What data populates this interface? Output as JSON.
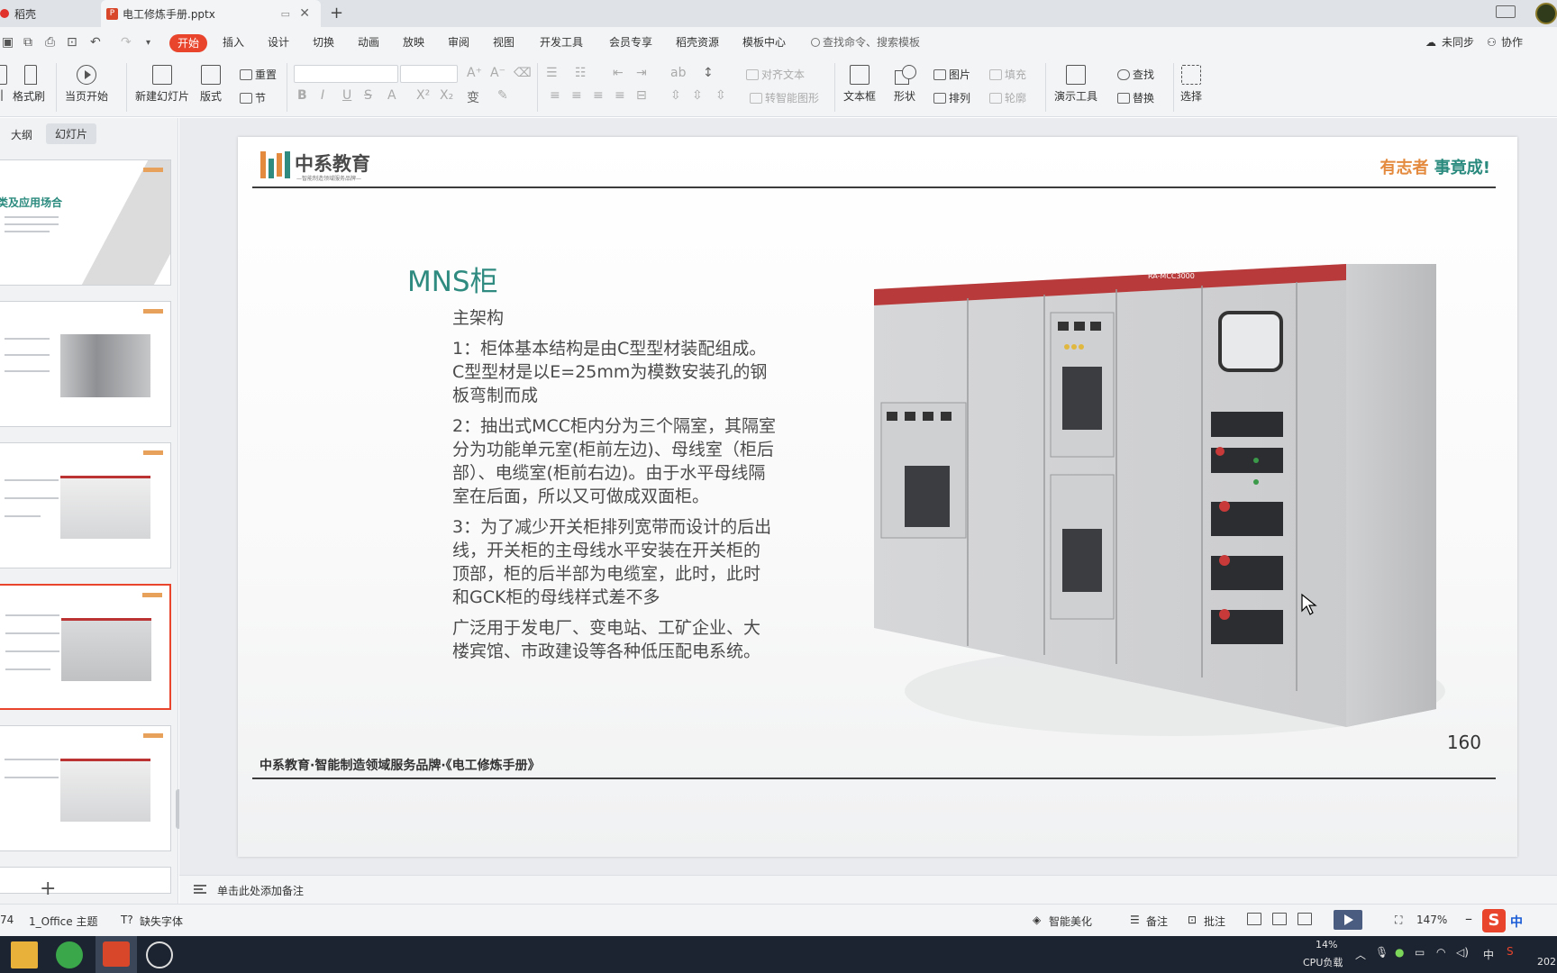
{
  "tabs": {
    "home_label": "稻壳",
    "doc_label": "电工修炼手册.pptx",
    "add": "+"
  },
  "menu": {
    "items": [
      "开始",
      "插入",
      "设计",
      "切换",
      "动画",
      "放映",
      "审阅",
      "视图",
      "开发工具",
      "会员专享",
      "稻壳资源",
      "模板中心"
    ],
    "search_placeholder": "查找命令、搜索模板",
    "sync": "未同步",
    "collab": "协作"
  },
  "ribbon": {
    "format_painter": "格式刷",
    "slideshow_from_current": "当页开始",
    "new_slide": "新建幻灯片",
    "layout": "版式",
    "reset": "重置",
    "section": "节",
    "align_text": "对齐文本",
    "to_smartart": "转智能图形",
    "textbox": "文本框",
    "shape": "形状",
    "picture": "图片",
    "fill": "填充",
    "arrange": "排列",
    "outline": "轮廓",
    "presentation_tools": "演示工具",
    "find": "查找",
    "replace": "替换",
    "select": "选择"
  },
  "left_panel": {
    "tab_outline": "大纲",
    "tab_slides": "幻灯片",
    "thumb1_title": "类及应用场合",
    "add_slide": "+"
  },
  "slide": {
    "logo_text": "中系教育",
    "logo_sub": "—智能制造领域服务品牌—",
    "slogan_a": "有志者",
    "slogan_b": "事竟成!",
    "title": "MNS柜",
    "paragraphs": [
      "主架构",
      "1：柜体基本结构是由C型型材装配组成。C型型材是以E=25mm为模数安装孔的钢板弯制而成",
      "2：抽出式MCC柜内分为三个隔室，其隔室分为功能单元室(柜前左边)、母线室（柜后部）、电缆室(柜前右边)。由于水平母线隔室在后面，所以又可做成双面柜。",
      "3：为了减少开关柜排列宽带而设计的后出线，开关柜的主母线水平安装在开关柜的顶部，柜的后半部为电缆室，此时，此时和GCK柜的母线样式差不多",
      "广泛用于发电厂、变电站、工矿企业、大楼宾馆、市政建设等各种低压配电系统。"
    ],
    "cabinet_label": "RA-MCC3000",
    "page_number": "160",
    "footer": "中系教育·智能制造领域服务品牌·《电工修炼手册》"
  },
  "notes": {
    "placeholder": "单击此处添加备注"
  },
  "status": {
    "slide_count": "74",
    "theme": "1_Office 主题",
    "missing_font": "缺失字体",
    "smart_beautify": "智能美化",
    "notes": "备注",
    "comments": "批注",
    "zoom": "147%",
    "ime": "中"
  },
  "taskbar": {
    "cpu_percent": "14%",
    "cpu_label": "CPU负载",
    "lang": "中",
    "year_fragment": "202"
  },
  "colors": {
    "accent": "#e8452c",
    "teal": "#2f8a80",
    "orange": "#e38a3e"
  }
}
